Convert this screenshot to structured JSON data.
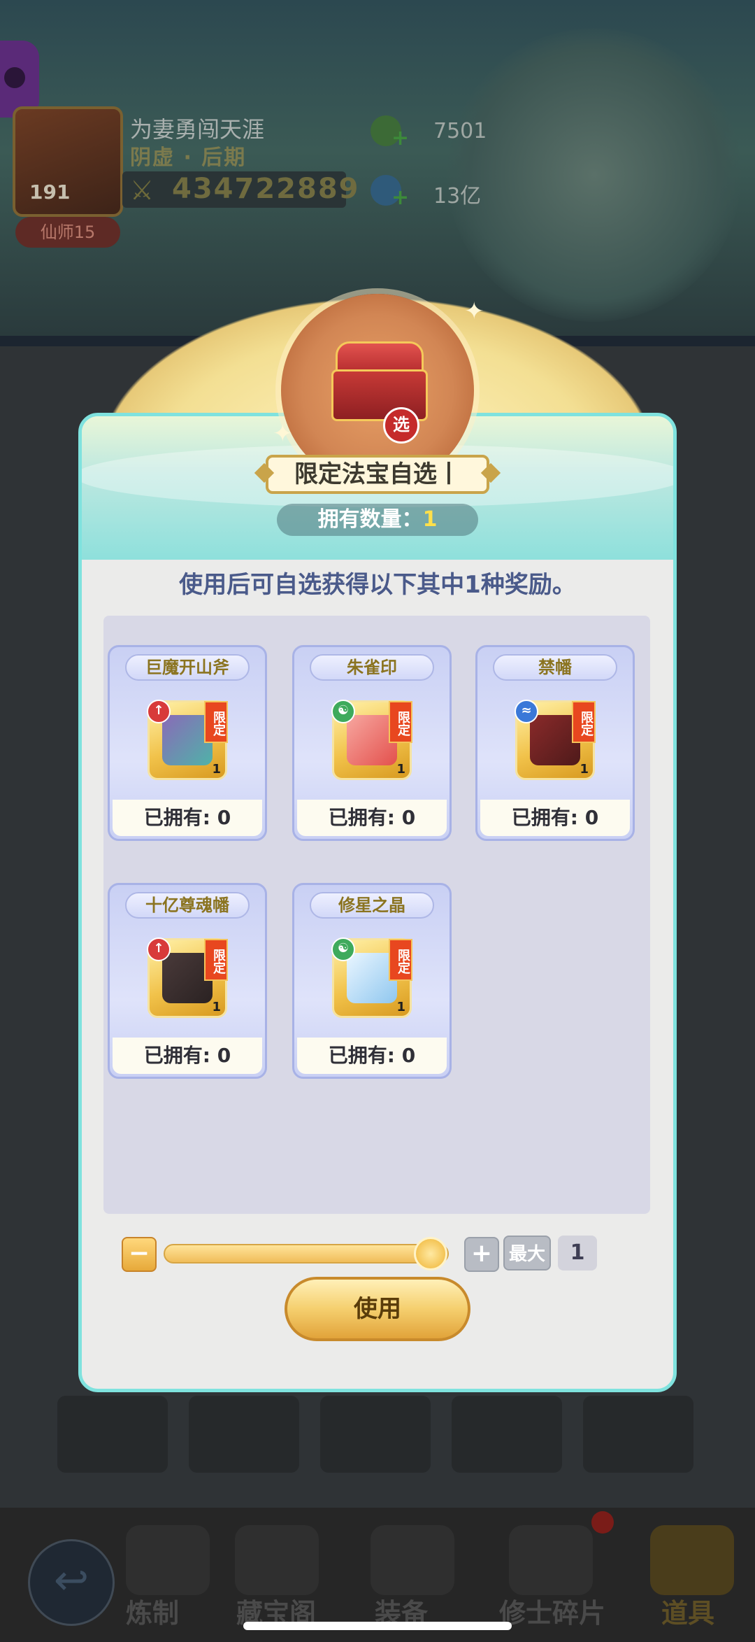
{
  "player": {
    "name": "为妻勇闯天涯",
    "title": "阴虚 · 后期",
    "level": "191",
    "rank": "仙师15",
    "power": "434722889"
  },
  "resources": [
    {
      "value": "7501",
      "icon": "jade-icon"
    },
    {
      "value": "13亿",
      "icon": "spirit-stone-icon"
    }
  ],
  "modal": {
    "title": "限定法宝自选丨",
    "owned_label": "拥有数量：",
    "owned_count": "1",
    "select_tag": "选",
    "description": "使用后可自选获得以下其中1种奖励。",
    "rewards": [
      {
        "name": "巨魔开山斧",
        "owned": "已拥有: 0",
        "count": "1",
        "limit": "限定",
        "element": "fire"
      },
      {
        "name": "朱雀印",
        "owned": "已拥有: 0",
        "count": "1",
        "limit": "限定",
        "element": "yinyang"
      },
      {
        "name": "禁幡",
        "owned": "已拥有: 0",
        "count": "1",
        "limit": "限定",
        "element": "water"
      },
      {
        "name": "十亿尊魂幡",
        "owned": "已拥有: 0",
        "count": "1",
        "limit": "限定",
        "element": "fire"
      },
      {
        "name": "修星之晶",
        "owned": "已拥有: 0",
        "count": "1",
        "limit": "限定",
        "element": "yinyang"
      }
    ],
    "quantity": {
      "minus": "−",
      "plus": "+",
      "max_label": "最大",
      "value": "1",
      "fraction": 1.0
    },
    "use_button": "使用"
  },
  "nav": {
    "tabs": [
      "炼制",
      "藏宝阁",
      "装备",
      "修士碎片",
      "道具"
    ],
    "active": "道具"
  },
  "colors": {
    "accent_gold": "#f0bd5a",
    "teal_border": "#7fe2de",
    "limit_red": "#e8471f",
    "desc_blue": "#4a5a8a"
  }
}
